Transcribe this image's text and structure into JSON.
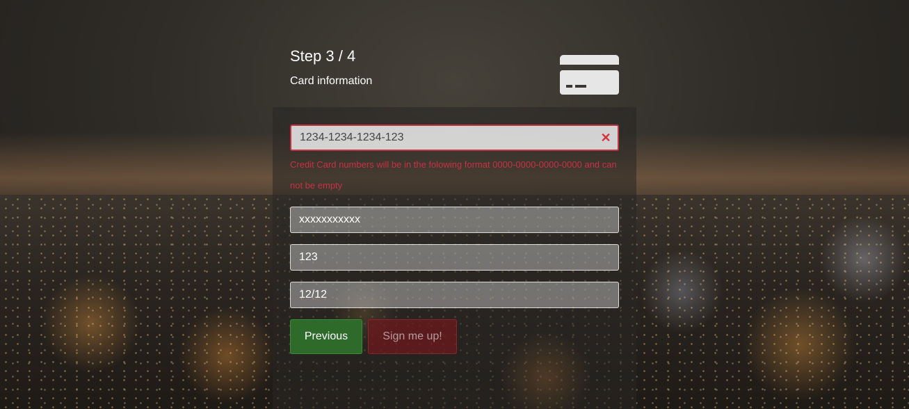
{
  "header": {
    "step": "Step 3 / 4",
    "subtitle": "Card information",
    "icon": "credit-card-icon"
  },
  "form": {
    "card_number": {
      "value": "1234-1234-1234-123",
      "error": "Credit Card numbers will be in the folowing format 0000-0000-0000-0000 and can not be empty",
      "clear_icon": "close-icon"
    },
    "card_holder": {
      "value": "xxxxxxxxxxx"
    },
    "cvv": {
      "value": "123"
    },
    "expiry": {
      "value": "12/12"
    }
  },
  "buttons": {
    "previous": "Previous",
    "signup": "Sign me up!"
  },
  "colors": {
    "error": "#c63244",
    "previous_bg": "#2e6b2a",
    "signup_bg": "#6e1a1e"
  }
}
